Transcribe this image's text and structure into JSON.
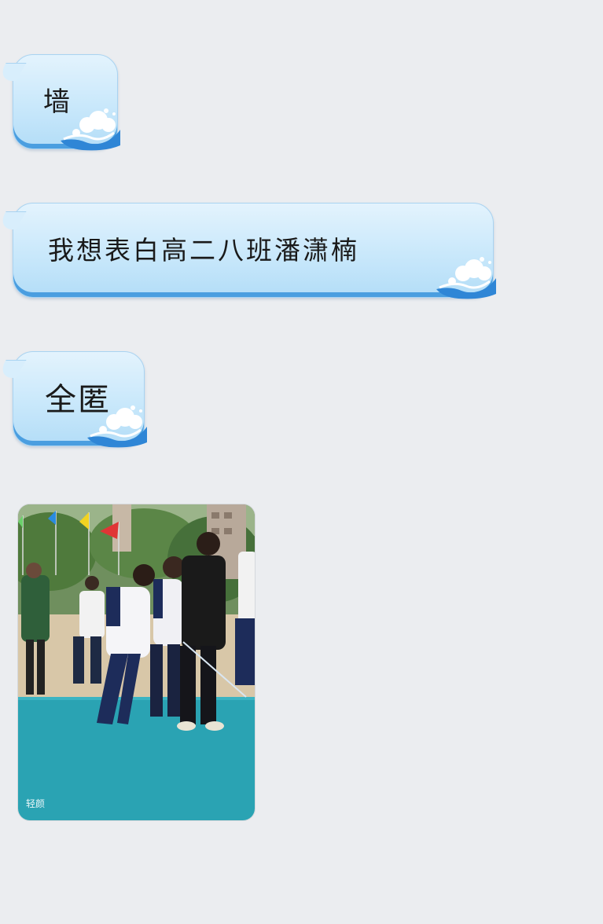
{
  "messages": [
    {
      "type": "text",
      "text": "墙"
    },
    {
      "type": "text",
      "text": "我想表白高二八班潘潇楠"
    },
    {
      "type": "text",
      "text": "全匿"
    },
    {
      "type": "image",
      "watermark": "轻颜",
      "icon": "photo-of-students-at-sports-field"
    }
  ],
  "colors": {
    "background": "#ebedf0",
    "bubble_light": "#e3f3fd",
    "bubble_edge": "#4a9ee0",
    "text": "#1a1a1a"
  }
}
